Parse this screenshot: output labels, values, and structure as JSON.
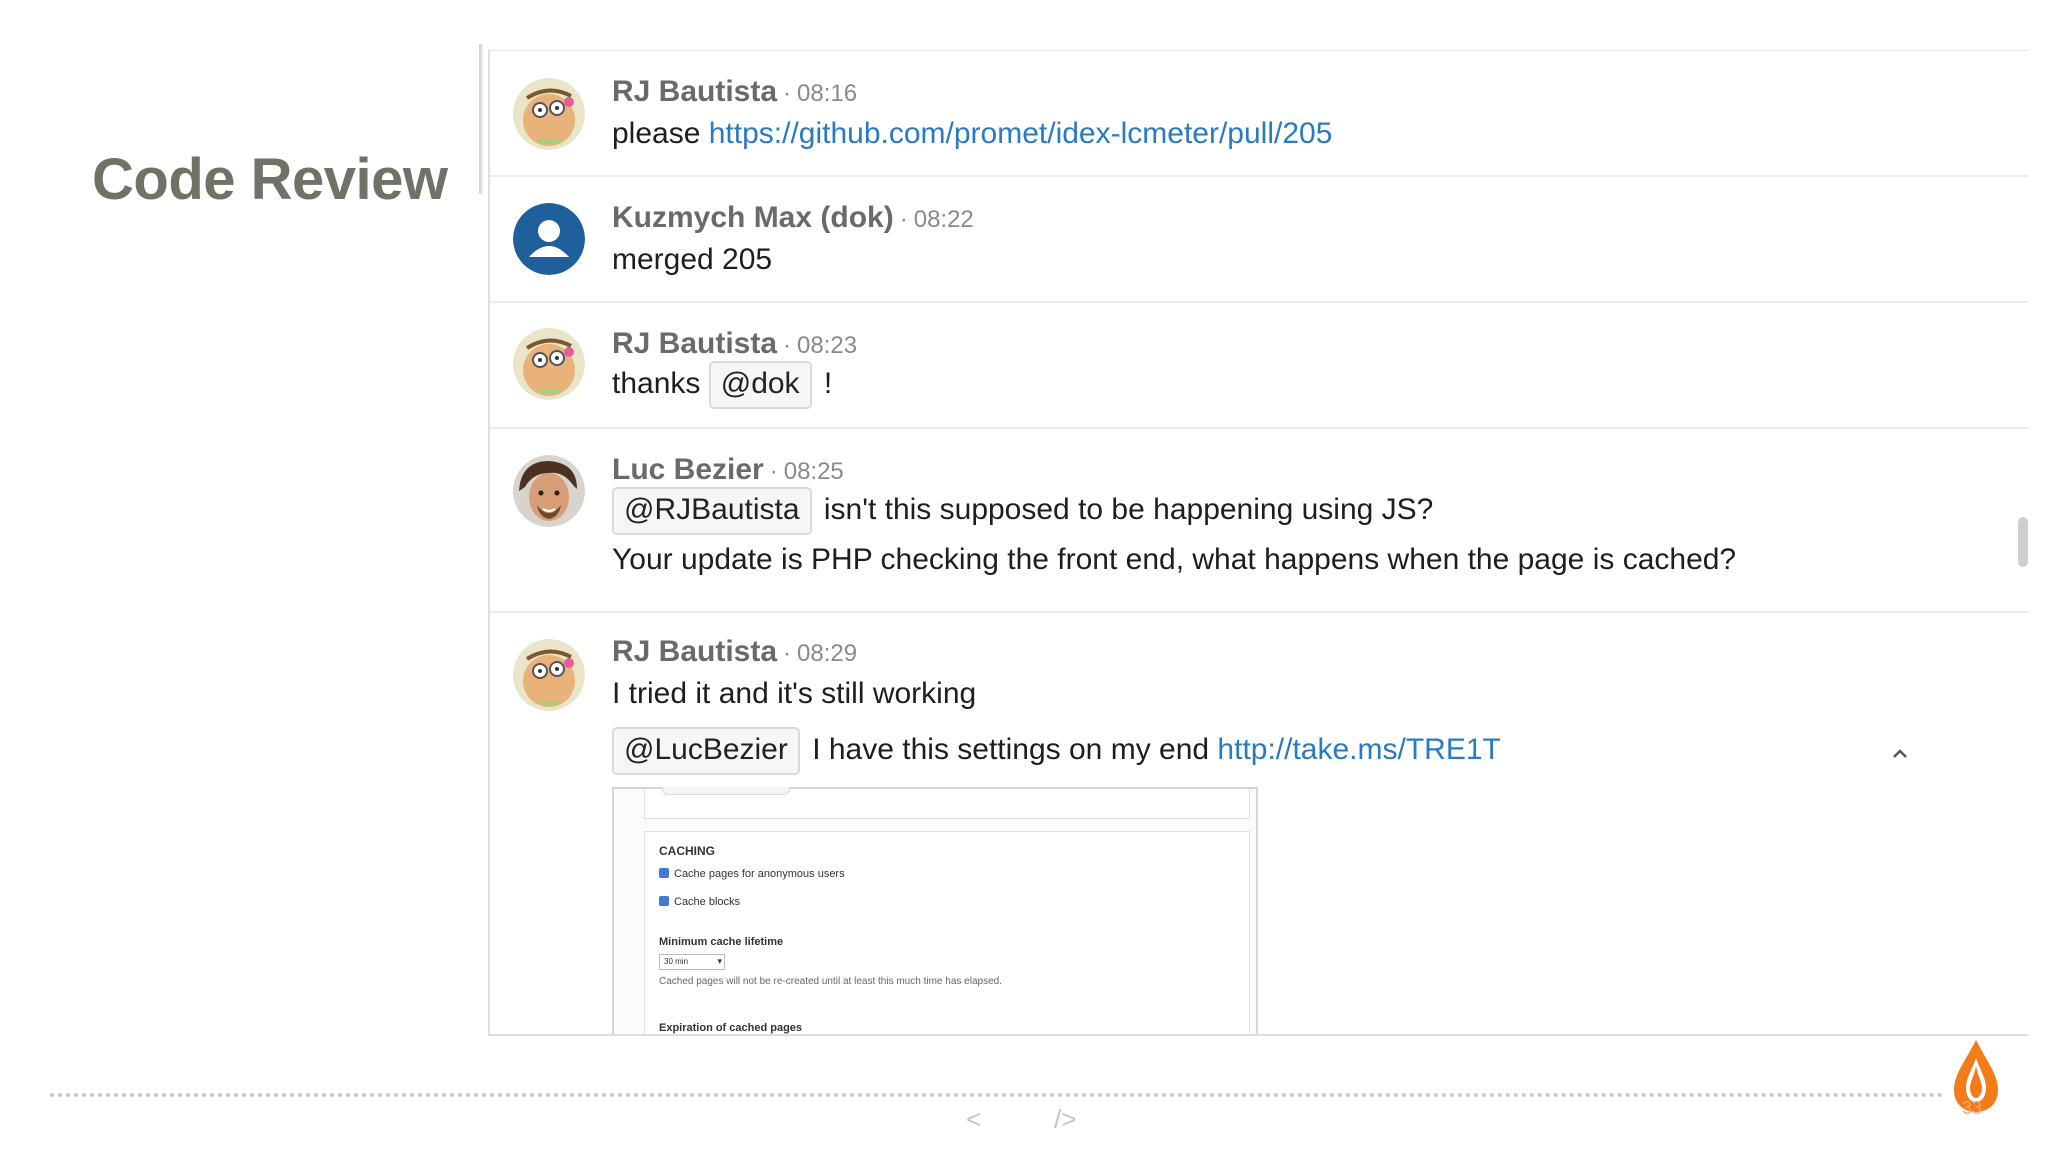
{
  "slide": {
    "title": "Code Review",
    "page_number": "33",
    "nav": {
      "prev": "<",
      "next": "/>"
    }
  },
  "colors": {
    "link": "#2a7ac0",
    "title": "#6f7366",
    "logo_orange": "#f07d1a"
  },
  "messages": [
    {
      "author": "RJ Bautista",
      "separator": "·",
      "time": "08:16",
      "avatar": "cartoon-avatar",
      "lines": [
        {
          "text": "please ",
          "link": "https://github.com/promet/idex-lcmeter/pull/205"
        }
      ]
    },
    {
      "author": "Kuzmych Max (dok)",
      "separator": "·",
      "time": "08:22",
      "avatar": "default-user-avatar",
      "lines": [
        {
          "text": "merged 205"
        }
      ]
    },
    {
      "author": "RJ Bautista",
      "separator": "·",
      "time": "08:23",
      "avatar": "cartoon-avatar",
      "lines": [
        {
          "before": "thanks ",
          "mention": "@dok",
          "after": " !"
        }
      ]
    },
    {
      "author": "Luc Bezier",
      "separator": "·",
      "time": "08:25",
      "avatar": "photo-avatar",
      "lines": [
        {
          "mention": "@RJBautista",
          "after": " isn't this supposed to be happening using JS?"
        },
        {
          "text": "Your update is PHP checking the front end, what happens when the page is cached?"
        }
      ]
    },
    {
      "author": "RJ Bautista",
      "separator": "·",
      "time": "08:29",
      "avatar": "cartoon-avatar",
      "lines": [
        {
          "text": "I tried it and it's still working"
        },
        {
          "mention": "@LucBezier",
          "after": " I have this settings on my end ",
          "link": "http://take.ms/TRE1T"
        }
      ],
      "attachment": {
        "section": "CACHING",
        "checkboxes": [
          "Cache pages for anonymous users",
          "Cache blocks"
        ],
        "min_lifetime_label": "Minimum cache lifetime",
        "min_lifetime_value": "30 min",
        "help": "Cached pages will not be re-created until at least this much time has elapsed.",
        "expiration_label": "Expiration of cached pages"
      }
    }
  ]
}
